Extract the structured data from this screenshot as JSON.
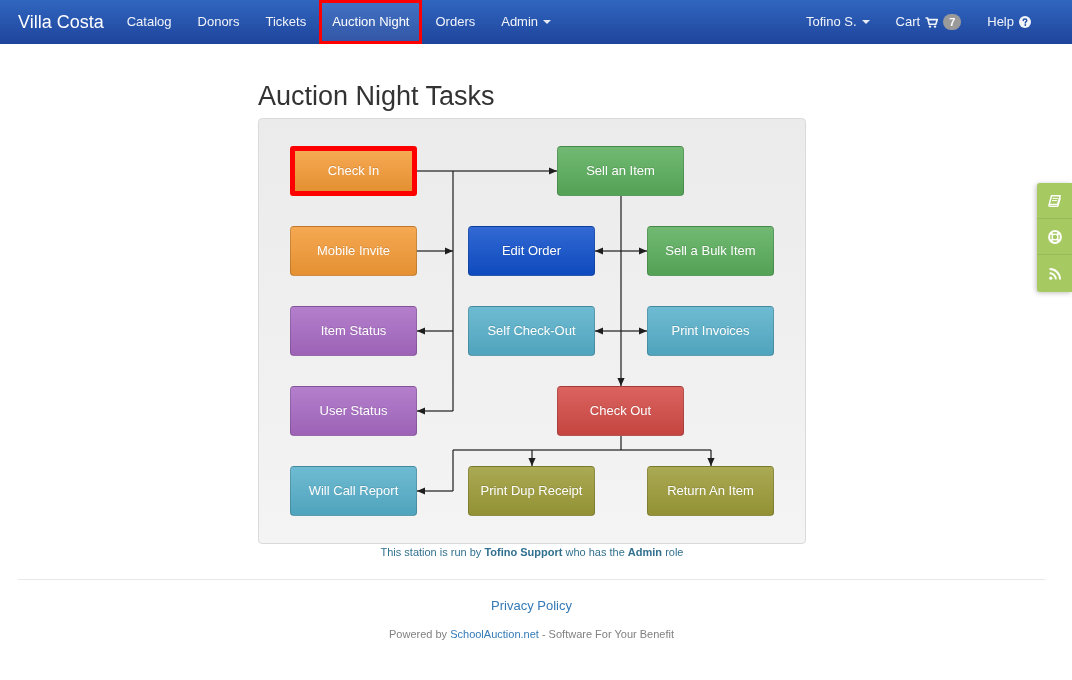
{
  "navbar": {
    "brand": "Villa Costa",
    "items": [
      {
        "label": "Catalog",
        "kind": "link",
        "selected": false,
        "highlighted": false
      },
      {
        "label": "Donors",
        "kind": "link",
        "selected": false,
        "highlighted": false
      },
      {
        "label": "Tickets",
        "kind": "link",
        "selected": false,
        "highlighted": false
      },
      {
        "label": "Auction Night",
        "kind": "link",
        "selected": true,
        "highlighted": true
      },
      {
        "label": "Orders",
        "kind": "link",
        "selected": false,
        "highlighted": false
      },
      {
        "label": "Admin",
        "kind": "dropdown",
        "selected": false,
        "highlighted": false
      }
    ],
    "user_menu": {
      "label": "Tofino S."
    },
    "cart": {
      "label": "Cart",
      "count": "7"
    },
    "help": {
      "label": "Help"
    }
  },
  "page": {
    "title": "Auction Night Tasks"
  },
  "tasks": [
    {
      "label": "Check In",
      "color": "#f59b36",
      "highlighted": true
    },
    {
      "label": "Sell an Item",
      "color": "#5aae5c",
      "highlighted": false
    },
    {
      "label": "Mobile Invite",
      "color": "#f59b36",
      "highlighted": false
    },
    {
      "label": "Edit Order",
      "color": "#1050cc",
      "highlighted": false
    },
    {
      "label": "Sell a Bulk Item",
      "color": "#5aae5c",
      "highlighted": false
    },
    {
      "label": "Item Status",
      "color": "#a86ac4",
      "highlighted": false
    },
    {
      "label": "Self Check-Out",
      "color": "#56b0cb",
      "highlighted": false
    },
    {
      "label": "Print Invoices",
      "color": "#56b0cb",
      "highlighted": false
    },
    {
      "label": "User Status",
      "color": "#a86ac4",
      "highlighted": false
    },
    {
      "label": "Check Out",
      "color": "#d44a45",
      "highlighted": false
    },
    {
      "label": "Will Call Report",
      "color": "#56b0cb",
      "highlighted": false
    },
    {
      "label": "Print Dup Receipt",
      "color": "#9d9c38",
      "highlighted": false
    },
    {
      "label": "Return An Item",
      "color": "#9d9c38",
      "highlighted": false
    }
  ],
  "station_note": "This station is run by **Tofino Support** who has the **Admin** role",
  "footer": {
    "privacy_link": "Privacy Policy",
    "powered_before": "Powered by",
    "powered_link": "SchoolAuction.net",
    "powered_after": "- Software For Your Benefit"
  }
}
